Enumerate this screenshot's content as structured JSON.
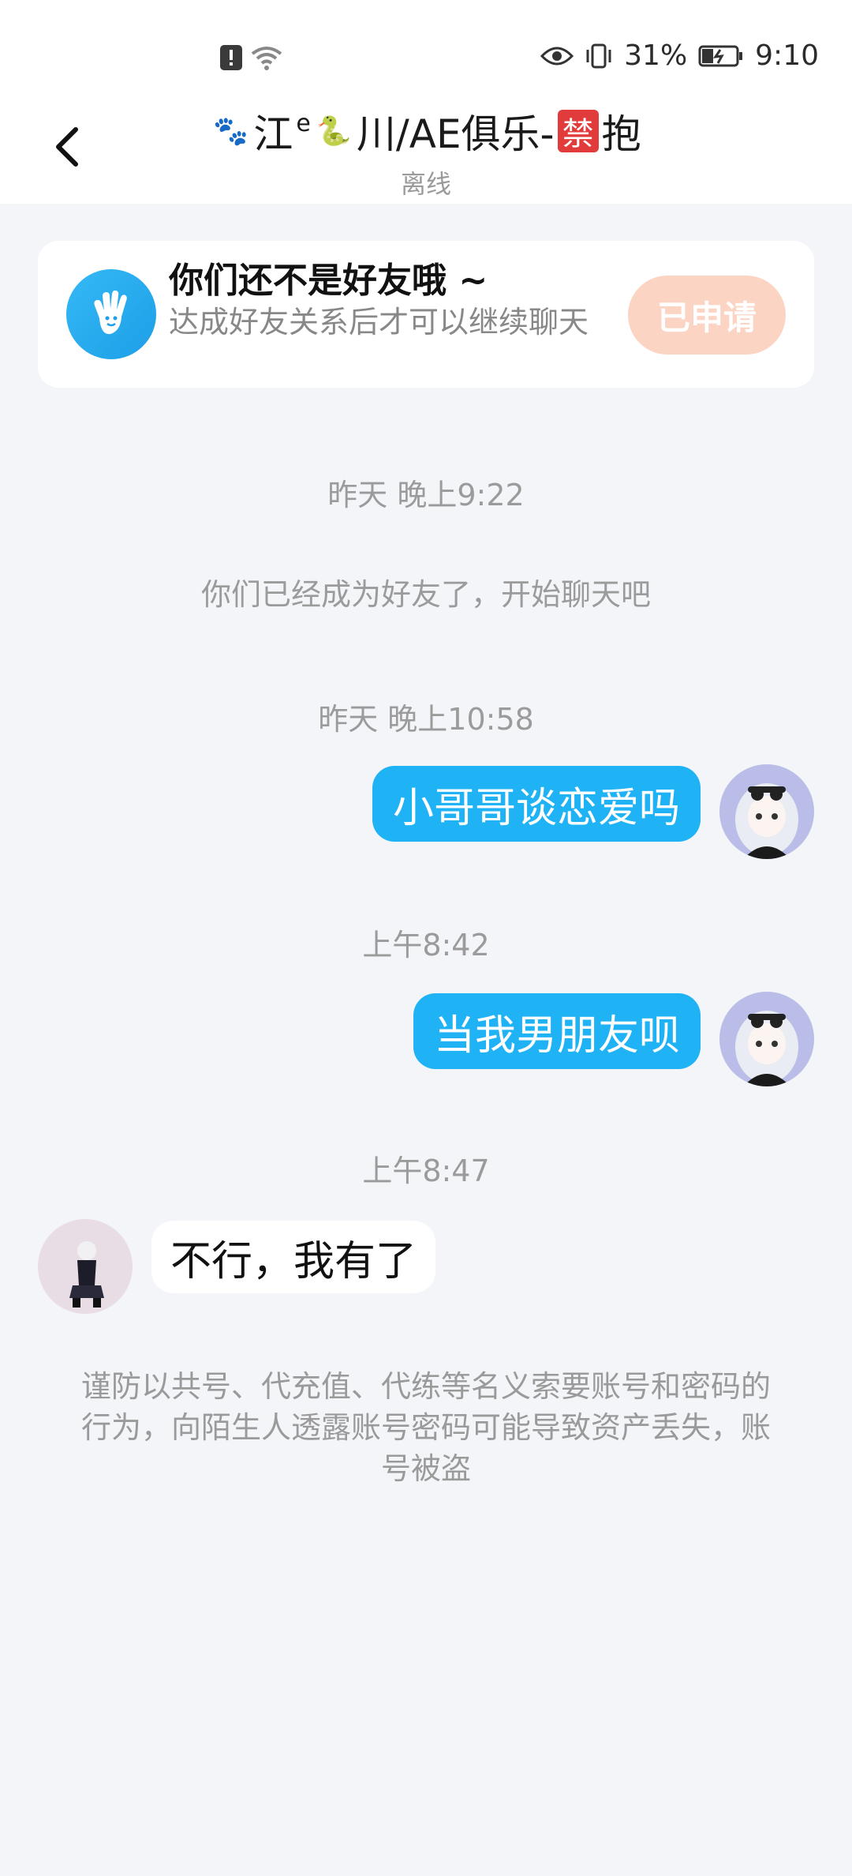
{
  "status_bar": {
    "battery_percent": "31%",
    "time": "9:10",
    "icons": [
      "alert-icon",
      "wifi-icon",
      "eye-icon",
      "vibrate-icon",
      "battery-icon"
    ]
  },
  "header": {
    "title_paw": "🐾",
    "title_part1": "江",
    "title_sup": "e",
    "title_snake": "🐍",
    "title_part2": "川/AE俱乐-",
    "title_ban": "禁",
    "title_part3": "抱",
    "status": "离线"
  },
  "notice": {
    "title": "你们还不是好友哦 ~",
    "desc": "达成好友关系后才可以继续聊天",
    "button_label": "已申请"
  },
  "chat": {
    "ts1": "昨天 晚上9:22",
    "system1": "你们已经成为好友了，开始聊天吧",
    "ts2": "昨天 晚上10:58",
    "msg1": "小哥哥谈恋爱吗",
    "ts3": "上午8:42",
    "msg2": "当我男朋友呗",
    "ts4": "上午8:47",
    "msg3": "不行，我有了"
  },
  "warning": "谨防以共号、代充值、代练等名义索要账号和密码的行为，向陌生人透露账号密码可能导致资产丢失，账号被盗",
  "colors": {
    "accent_blue": "#1fb2f5",
    "applied_button": "#fcd4c3",
    "background": "#f3f5f9"
  }
}
